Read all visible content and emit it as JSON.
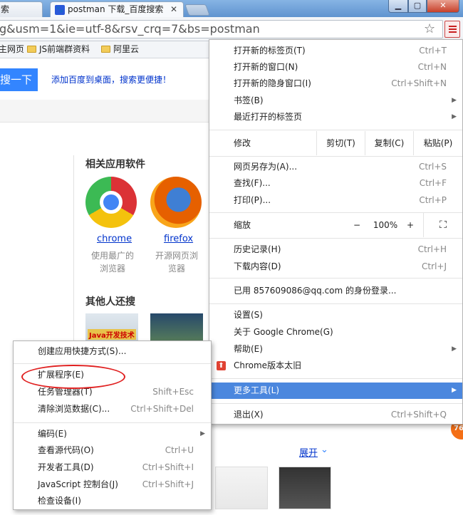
{
  "tabs": [
    {
      "label": "索"
    },
    {
      "label": "postman 下载_百度搜索",
      "close": "✕"
    }
  ],
  "window": {
    "minimize": "▁",
    "maximize": "▢",
    "close": "✕"
  },
  "omnibox": {
    "value": "g&usm=1&ie=utf-8&rsv_crq=7&bs=postman"
  },
  "bookmarks": [
    {
      "label": "主网页"
    },
    {
      "label": "JS前端群资料"
    },
    {
      "label": "阿里云"
    }
  ],
  "page": {
    "search_button": "搜一下",
    "promo": "添加百度到桌面，搜索更便捷！",
    "related_title": "相关应用软件",
    "apps": [
      {
        "name": "chrome",
        "desc_lines": [
          "使用最广的",
          "浏览器"
        ]
      },
      {
        "name": "firefox",
        "desc_lines": [
          "开源网页浏",
          "览器"
        ]
      }
    ],
    "others_title": "其他人还搜",
    "thumb1_text": "Java开发技术",
    "expand": "展开",
    "badge": "76"
  },
  "menu": {
    "items_top": [
      {
        "label": "打开新的标签页(T)",
        "shortcut": "Ctrl+T"
      },
      {
        "label": "打开新的窗口(N)",
        "shortcut": "Ctrl+N"
      },
      {
        "label": "打开新的隐身窗口(I)",
        "shortcut": "Ctrl+Shift+N"
      },
      {
        "label": "书签(B)",
        "arrow": "▶"
      },
      {
        "label": "最近打开的标签页",
        "arrow": "▶"
      }
    ],
    "edit": {
      "label": "修改",
      "cut": "剪切(T)",
      "copy": "复制(C)",
      "paste": "粘贴(P)"
    },
    "items_file": [
      {
        "label": "网页另存为(A)...",
        "shortcut": "Ctrl+S"
      },
      {
        "label": "查找(F)...",
        "shortcut": "Ctrl+F"
      },
      {
        "label": "打印(P)...",
        "shortcut": "Ctrl+P"
      }
    ],
    "zoom": {
      "label": "缩放",
      "minus": "−",
      "value": "100%",
      "plus": "+",
      "fullscreen": "⛶"
    },
    "items_history": [
      {
        "label": "历史记录(H)",
        "shortcut": "Ctrl+H"
      },
      {
        "label": "下载内容(D)",
        "shortcut": "Ctrl+J"
      }
    ],
    "signin": "已用 857609086@qq.com 的身份登录...",
    "items_settings": [
      {
        "label": "设置(S)"
      },
      {
        "label": "关于 Google Chrome(G)"
      },
      {
        "label": "帮助(E)",
        "arrow": "▶"
      },
      {
        "label": "Chrome版本太旧"
      }
    ],
    "more_tools": {
      "label": "更多工具(L)",
      "arrow": "▶"
    },
    "exit": {
      "label": "退出(X)",
      "shortcut": "Ctrl+Shift+Q"
    }
  },
  "submenu": {
    "items_a": [
      {
        "label": "创建应用快捷方式(S)..."
      }
    ],
    "items_b": [
      {
        "label": "扩展程序(E)"
      },
      {
        "label": "任务管理器(T)",
        "shortcut": "Shift+Esc"
      },
      {
        "label": "清除浏览数据(C)...",
        "shortcut": "Ctrl+Shift+Del"
      }
    ],
    "items_c": [
      {
        "label": "编码(E)",
        "arrow": "▶"
      },
      {
        "label": "查看源代码(O)",
        "shortcut": "Ctrl+U"
      },
      {
        "label": "开发者工具(D)",
        "shortcut": "Ctrl+Shift+I"
      },
      {
        "label": "JavaScript 控制台(J)",
        "shortcut": "Ctrl+Shift+J"
      },
      {
        "label": "检查设备(I)"
      }
    ]
  },
  "colors": {
    "highlight": "#4b87de",
    "annotation": "#e02020",
    "search_blue": "#3385ff"
  }
}
